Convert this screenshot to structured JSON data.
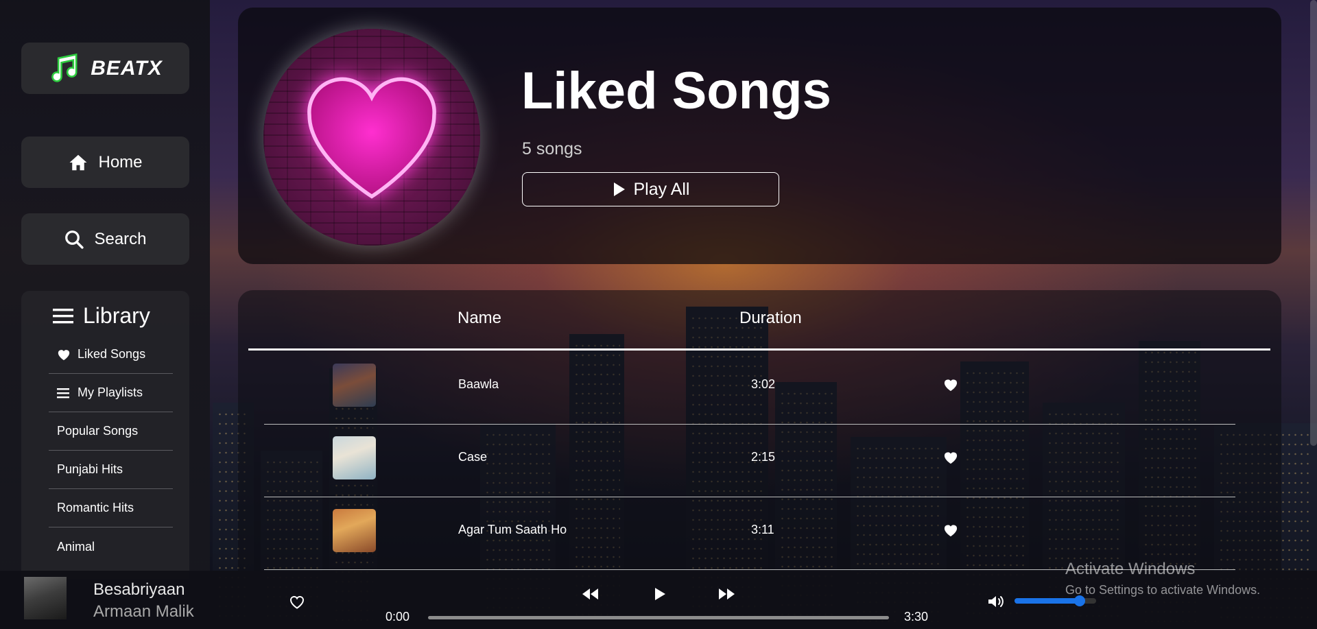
{
  "brand": {
    "name": "BEATX",
    "accent": "#2ecc40"
  },
  "nav": {
    "home_label": "Home",
    "search_label": "Search"
  },
  "library": {
    "title": "Library",
    "items": [
      {
        "label": "Liked Songs",
        "icon": "heart-icon"
      },
      {
        "label": "My Playlists",
        "icon": "list-icon"
      },
      {
        "label": "Popular Songs"
      },
      {
        "label": "Punjabi Hits"
      },
      {
        "label": "Romantic Hits"
      },
      {
        "label": "Animal"
      }
    ]
  },
  "hero": {
    "title": "Liked Songs",
    "count": "5 songs",
    "play_all_label": "Play All"
  },
  "table": {
    "headers": {
      "name": "Name",
      "duration": "Duration"
    },
    "rows": [
      {
        "name": "Baawla",
        "duration": "3:02"
      },
      {
        "name": "Case",
        "duration": "2:15"
      },
      {
        "name": "Agar Tum Saath Ho",
        "duration": "3:11"
      }
    ]
  },
  "player": {
    "title": "Besabriyaan",
    "artist": "Armaan Malik",
    "current_time": "0:00",
    "total_time": "3:30",
    "progress": 0,
    "volume": 0.8,
    "volume_color": "#1a73e8"
  },
  "overlay": {
    "line1": "Activate Windows",
    "line2": "Go to Settings to activate Windows."
  }
}
